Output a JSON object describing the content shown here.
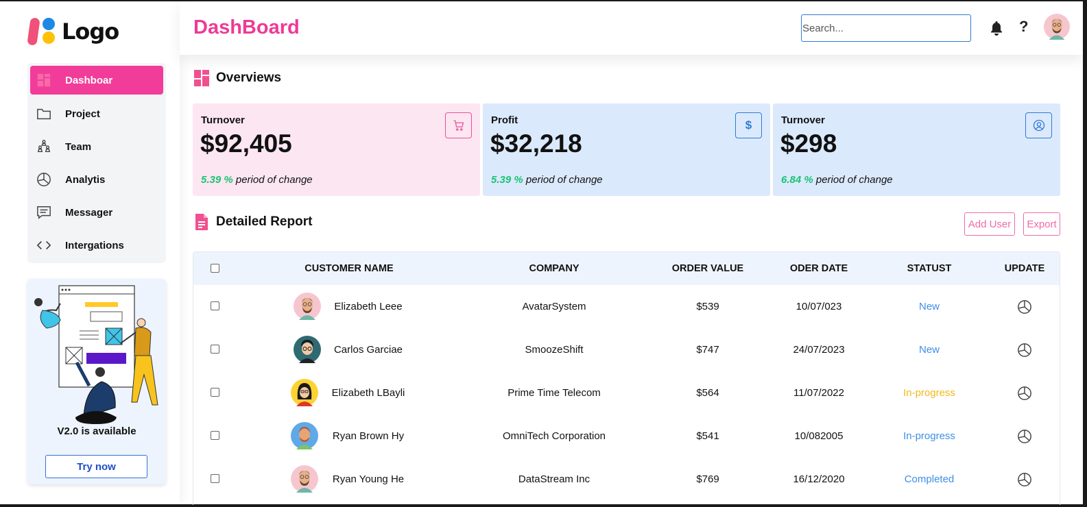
{
  "logo": {
    "text": "Logo"
  },
  "sidebar": {
    "items": [
      {
        "label": "Dashboar",
        "icon": "grid-icon",
        "active": true
      },
      {
        "label": "Project",
        "icon": "folder-icon"
      },
      {
        "label": "Team",
        "icon": "team-icon"
      },
      {
        "label": "Analytis",
        "icon": "pie-chart-icon"
      },
      {
        "label": "Messager",
        "icon": "message-icon"
      },
      {
        "label": "Intergations",
        "icon": "code-icon"
      }
    ],
    "promo": {
      "version_text": "V2.0 is available",
      "button_label": "Try now"
    }
  },
  "header": {
    "title": "DashBoard",
    "search_placeholder": "Search...",
    "help_label": "?"
  },
  "overview": {
    "title": "Overviews",
    "cards": [
      {
        "label": "Turnover",
        "value": "$92,405",
        "change_pct": "5.39 %",
        "change_text": " period of change",
        "icon": "cart-icon",
        "color": "#fce6f1"
      },
      {
        "label": "Profit",
        "value": "$32,218",
        "change_pct": "5.39 %",
        "change_text": " period of change",
        "icon": "dollar-icon",
        "color": "#dbe9fc"
      },
      {
        "label": "Turnover",
        "value": "$298",
        "change_pct": "6.84 %",
        "change_text": " period of change",
        "icon": "user-circle-icon",
        "color": "#dbe9fc"
      }
    ]
  },
  "report": {
    "title": "Detailed Report",
    "add_user_label": "Add User",
    "export_label": "Export",
    "columns": [
      "CUSTOMER NAME",
      "COMPANY",
      "ORDER VALUE",
      "ODER DATE",
      "STATUST",
      "UPDATE"
    ],
    "rows": [
      {
        "name": "Elizabeth Leee",
        "company": "AvatarSystem",
        "value": "$539",
        "date": "10/07/023",
        "status": "New"
      },
      {
        "name": "Carlos Garciae",
        "company": "SmoozeShift",
        "value": "$747",
        "date": "24/07/2023",
        "status": "New"
      },
      {
        "name": "Elizabeth LBayli",
        "company": "Prime Time Telecom",
        "value": "$564",
        "date": "11/07/2022",
        "status": "In-progress"
      },
      {
        "name": "Ryan Brown Hy",
        "company": "OmniTech Corporation",
        "value": "$541",
        "date": "10/082005",
        "status": "In-progress"
      },
      {
        "name": "Ryan Young He",
        "company": "DataStream Inc",
        "value": "$769",
        "date": "16/12/2020",
        "status": "Completed"
      }
    ]
  },
  "colors": {
    "brand_pink": "#ee3a95",
    "accent_blue": "#2e7bd6",
    "positive_green": "#19c472",
    "status_yellow": "#f2b81a",
    "status_blue": "#3d8fe6"
  }
}
